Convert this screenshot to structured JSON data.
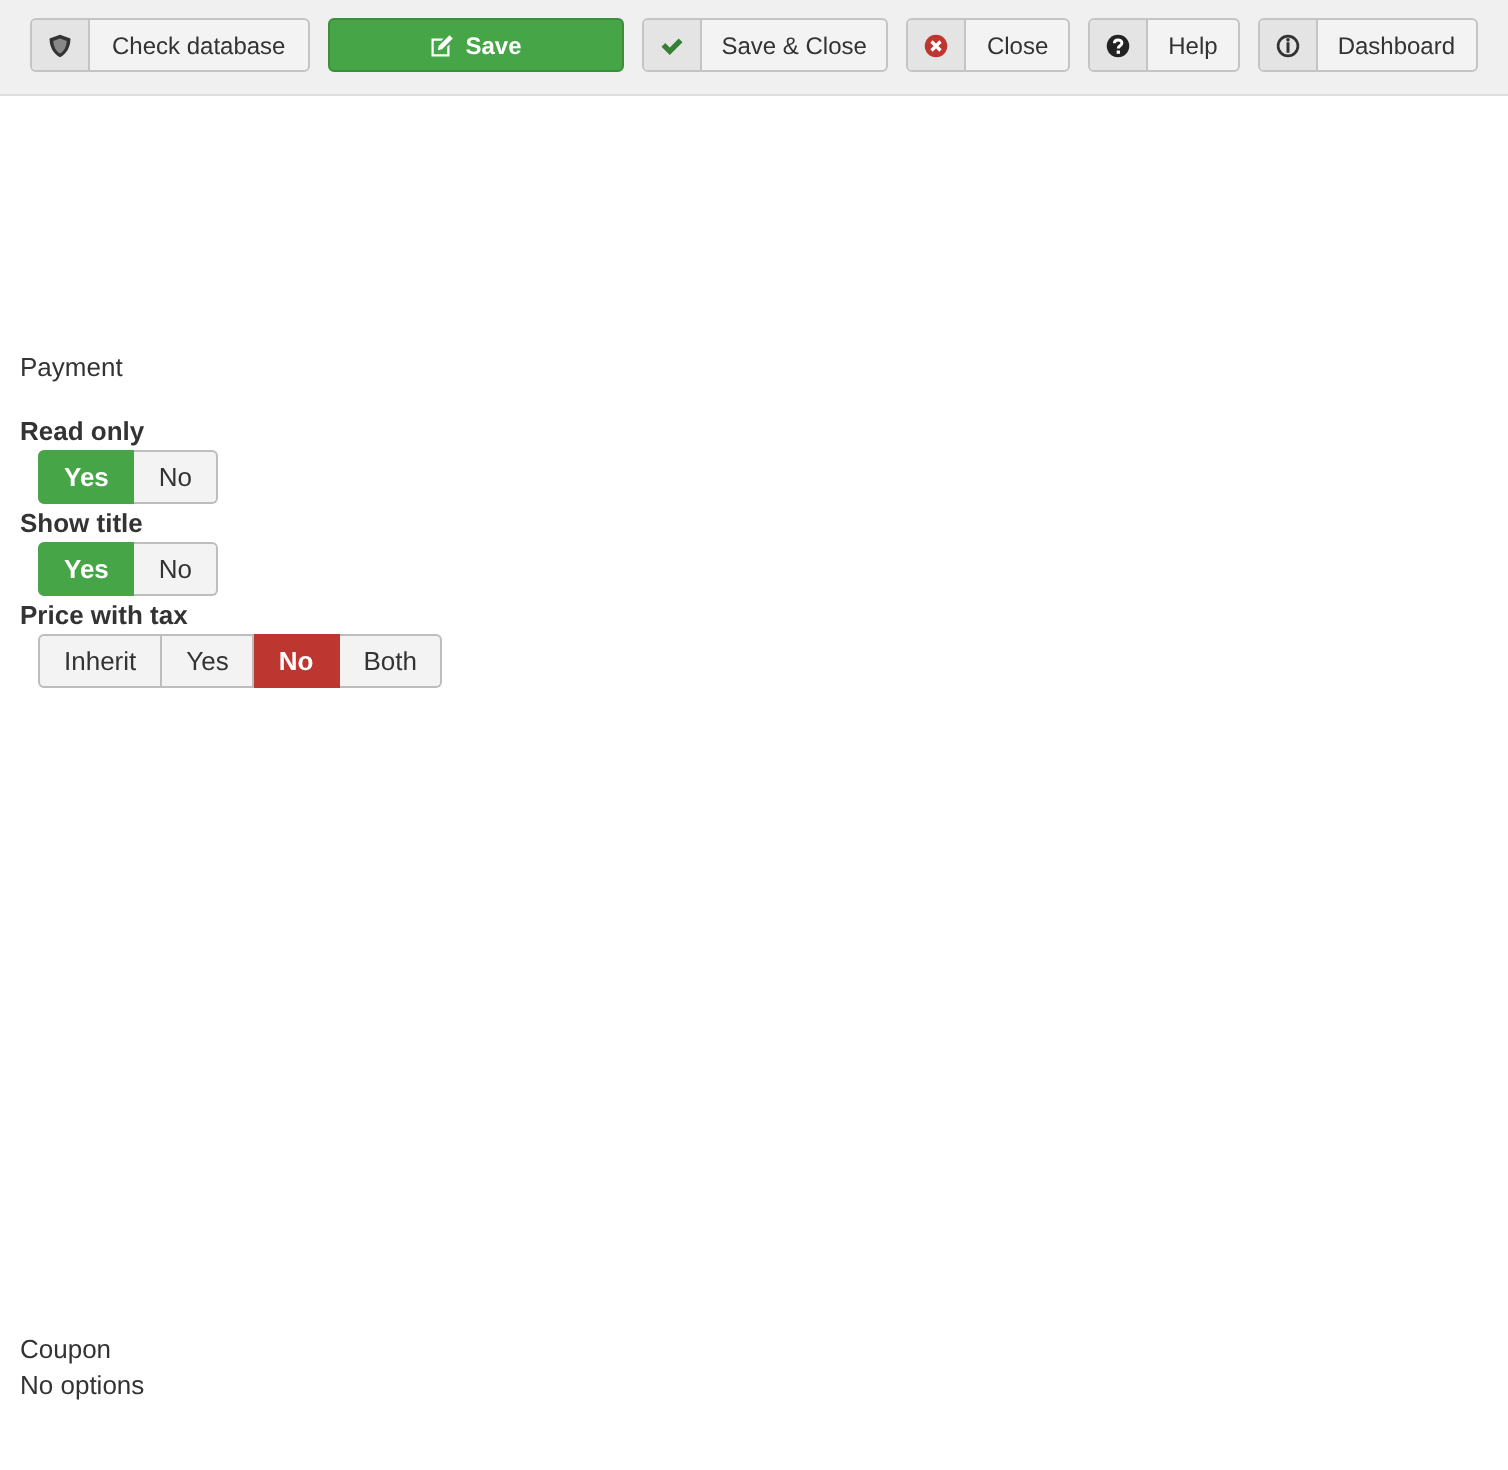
{
  "toolbar": {
    "buttons": [
      {
        "kind": "check",
        "label": "Check database"
      },
      {
        "kind": "save",
        "label": "Save"
      },
      {
        "kind": "apply",
        "label": "Save & Close"
      },
      {
        "kind": "close",
        "label": "Close"
      },
      {
        "kind": "help",
        "label": "Help"
      },
      {
        "kind": "dashboard",
        "label": "Dashboard"
      }
    ]
  },
  "sections": [
    {
      "title": "Payment",
      "fields": [
        {
          "label": "Read only",
          "color": "#46a546",
          "options": [
            {
              "label": "Yes",
              "selected": true
            },
            {
              "label": "No",
              "selected": false
            }
          ]
        },
        {
          "label": "Show title",
          "color": "#46a546",
          "options": [
            {
              "label": "Yes",
              "selected": true
            },
            {
              "label": "No",
              "selected": false
            }
          ]
        },
        {
          "label": "Price with tax",
          "color": "#bd362f",
          "options": [
            {
              "label": "Inherit",
              "selected": false
            },
            {
              "label": "Yes",
              "selected": false
            },
            {
              "label": "No",
              "selected": true
            },
            {
              "label": "Both",
              "selected": false
            }
          ]
        }
      ]
    },
    {
      "title": "Coupon",
      "empty_text": "No options"
    }
  ]
}
